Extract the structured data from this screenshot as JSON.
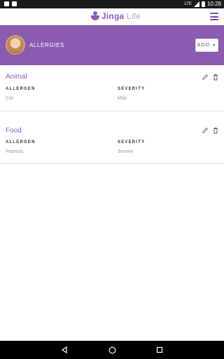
{
  "status_bar": {
    "time": "10:28",
    "network": "LTE"
  },
  "app": {
    "logo_primary": "Jinga",
    "logo_secondary": "Life",
    "menu_icon": "hamburger-icon"
  },
  "header": {
    "title": "ALLERGIES",
    "add_label": "ADD",
    "add_caret": "▼"
  },
  "sections": [
    {
      "title": "Animal",
      "allergen_label": "ALLERGEN",
      "severity_label": "SEVERITY",
      "allergen_value": "Cat",
      "severity_value": "Mild"
    },
    {
      "title": "Food",
      "allergen_label": "ALLERGEN",
      "severity_label": "SEVERITY",
      "allergen_value": "Peanuts",
      "severity_value": "Severe"
    }
  ],
  "colors": {
    "brand_purple": "#8b5bb1",
    "header_bg": "#8b5bb1",
    "muted_text": "#999999"
  }
}
